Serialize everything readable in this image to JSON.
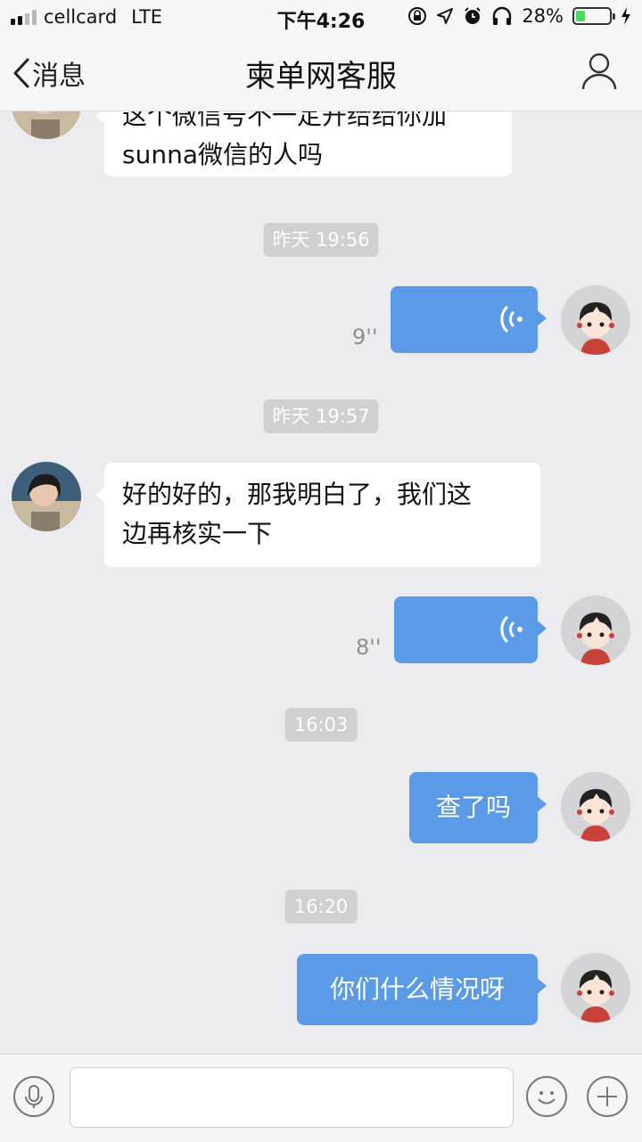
{
  "status_bar": {
    "carrier": "cellcard",
    "network": "LTE",
    "time": "下午4:26",
    "battery_percent": "28%",
    "battery_level": 0.28
  },
  "nav": {
    "back_label": "消息",
    "title": "柬单网客服",
    "profile_icon": "person-icon"
  },
  "messages": {
    "m1_text": "这个微信号不一定开给给你加\nsunna微信的人吗",
    "ts1": "昨天 19:56",
    "m2_duration": "9''",
    "ts2": "昨天 19:57",
    "m3_text": "好的好的，那我明白了，我们这\n边再核实一下",
    "m4_duration": "8''",
    "ts3": "16:03",
    "m5_text": "查了吗",
    "ts4": "16:20",
    "m6_text": "你们什么情况呀"
  },
  "input_bar": {
    "voice_icon": "microphone-icon",
    "emoji_icon": "smiley-icon",
    "more_icon": "plus-icon",
    "value": ""
  },
  "colors": {
    "outgoing_bubble": "#5a9ae6",
    "incoming_bubble": "#ffffff",
    "background": "#ebebf0"
  }
}
